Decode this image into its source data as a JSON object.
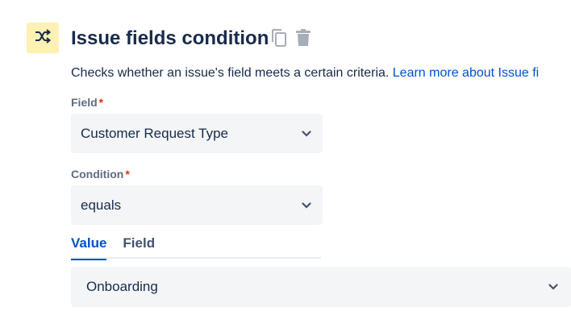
{
  "header": {
    "icon": "shuffle-icon",
    "title": "Issue fields condition",
    "actions": [
      "copy-icon",
      "trash-icon"
    ]
  },
  "description": {
    "text": "Checks whether an issue's field meets a certain criteria. ",
    "link": "Learn more about Issue fi"
  },
  "field": {
    "label": "Field",
    "required": "*",
    "value": "Customer Request Type"
  },
  "condition": {
    "label": "Condition",
    "required": "*",
    "value": "equals"
  },
  "tabs": {
    "value_label": "Value",
    "field_label": "Field",
    "active": "Value"
  },
  "value_select": {
    "value": "Onboarding"
  },
  "colors": {
    "accent": "#0052cc",
    "icon_tile": "#fff0b3",
    "required": "#de350b",
    "field_bg": "#f4f5f7"
  }
}
